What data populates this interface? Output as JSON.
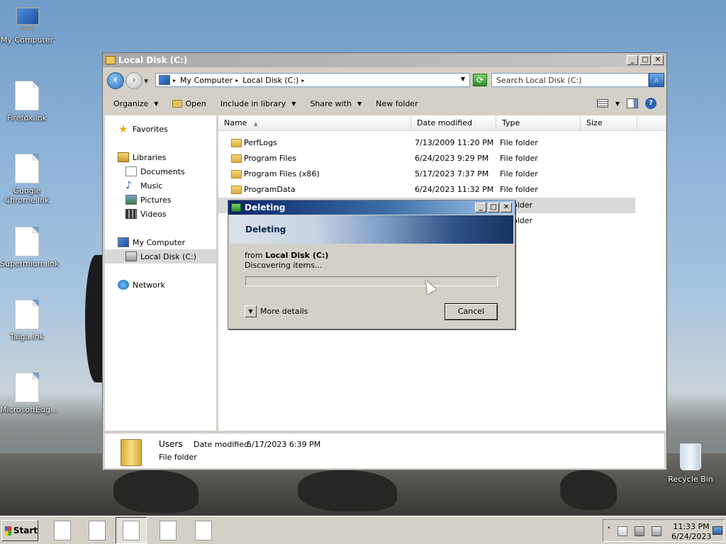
{
  "desktop": {
    "icons": [
      {
        "label": "My Computer"
      },
      {
        "label": "Firefox.lnk"
      },
      {
        "label": "Google Chrome.lnk"
      },
      {
        "label": "Supermium.lnk"
      },
      {
        "label": "Taiga.lnk"
      },
      {
        "label": "MicrosoftEdg..."
      }
    ],
    "recycle_bin": "Recycle Bin"
  },
  "explorer": {
    "title": "Local Disk (C:)",
    "title_buttons": {
      "minimize": "_",
      "maximize": "□",
      "close": "✕"
    },
    "address": {
      "crumbs": [
        "My Computer",
        "Local Disk (C:)"
      ]
    },
    "search_placeholder": "Search Local Disk (C:)",
    "toolbar": {
      "organize": "Organize",
      "open": "Open",
      "include": "Include in library",
      "share": "Share with",
      "new_folder": "New folder"
    },
    "nav": {
      "favorites": "Favorites",
      "libraries": "Libraries",
      "documents": "Documents",
      "music": "Music",
      "pictures": "Pictures",
      "videos": "Videos",
      "my_computer": "My Computer",
      "local_disk": "Local Disk (C:)",
      "network": "Network"
    },
    "columns": {
      "name": "Name",
      "date": "Date modified",
      "type": "Type",
      "size": "Size"
    },
    "files": [
      {
        "name": "PerfLogs",
        "date": "7/13/2009 11:20 PM",
        "type": "File folder"
      },
      {
        "name": "Program Files",
        "date": "6/24/2023 9:29 PM",
        "type": "File folder"
      },
      {
        "name": "Program Files (x86)",
        "date": "5/17/2023 7:37 PM",
        "type": "File folder"
      },
      {
        "name": "ProgramData",
        "date": "6/24/2023 11:32 PM",
        "type": "File folder"
      },
      {
        "name": "",
        "date": "",
        "type": "older"
      },
      {
        "name": "",
        "date": "",
        "type": "older"
      }
    ],
    "details": {
      "name": "Users",
      "date_label": "Date modified:",
      "date_value": "5/17/2023 6:39 PM",
      "kind": "File folder"
    }
  },
  "dialog": {
    "title": "Deleting",
    "header": "Deleting",
    "from_label": "from",
    "from_value": "Local Disk (C:)",
    "status": "Discovering items...",
    "progress": 0,
    "more_details": "More details",
    "cancel": "Cancel"
  },
  "taskbar": {
    "start": "Start",
    "time": "11:33 PM",
    "date": "6/24/2023"
  }
}
